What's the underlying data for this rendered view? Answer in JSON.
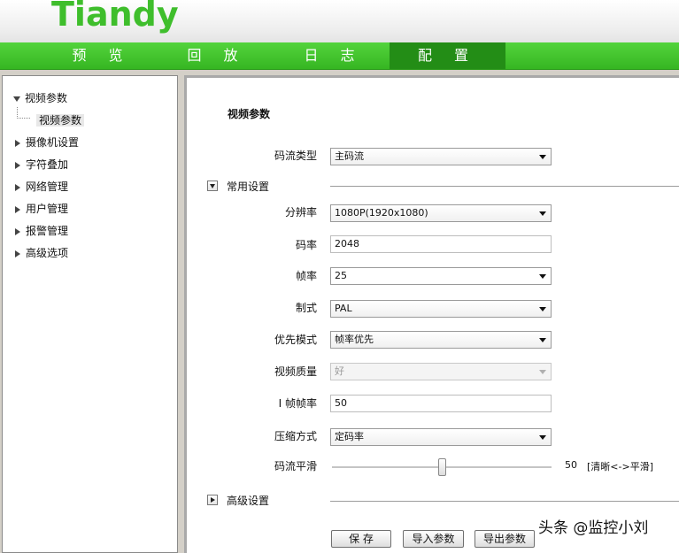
{
  "brand": {
    "logo": "Tiandy"
  },
  "nav": {
    "tabs": [
      {
        "label": "预 览"
      },
      {
        "label": "回 放"
      },
      {
        "label": "日 志"
      },
      {
        "label": "配 置",
        "active": true
      }
    ],
    "active_color": "#238d16",
    "bar_color": "#3fbe2c"
  },
  "tree": {
    "items": [
      {
        "label": "视频参数",
        "expanded": true
      },
      {
        "label": "视频参数",
        "child": true,
        "selected": true
      },
      {
        "label": "摄像机设置"
      },
      {
        "label": "字符叠加"
      },
      {
        "label": "网络管理"
      },
      {
        "label": "用户管理"
      },
      {
        "label": "报警管理"
      },
      {
        "label": "高级选项"
      }
    ]
  },
  "content": {
    "title": "视频参数",
    "stream_type": {
      "label": "码流类型",
      "value": "主码流"
    },
    "common_group": {
      "label": "常用设置"
    },
    "resolution": {
      "label": "分辨率",
      "value": "1080P(1920x1080)"
    },
    "bitrate": {
      "label": "码率",
      "value": "2048"
    },
    "framerate": {
      "label": "帧率",
      "value": "25"
    },
    "standard": {
      "label": "制式",
      "value": "PAL"
    },
    "priority": {
      "label": "优先模式",
      "value": "帧率优先"
    },
    "quality": {
      "label": "视频质量",
      "value": "好"
    },
    "iframe": {
      "label": "I 帧帧率",
      "value": "50"
    },
    "compression": {
      "label": "压缩方式",
      "value": "定码率"
    },
    "smooth": {
      "label": "码流平滑",
      "value": "50",
      "hint": "[清晰<->平滑]",
      "level_fraction": 0.5
    },
    "advanced_group": {
      "label": "高级设置"
    },
    "buttons": {
      "save": "保 存",
      "import": "导入参数",
      "export": "导出参数"
    }
  },
  "watermark": "头条 @监控小刘"
}
